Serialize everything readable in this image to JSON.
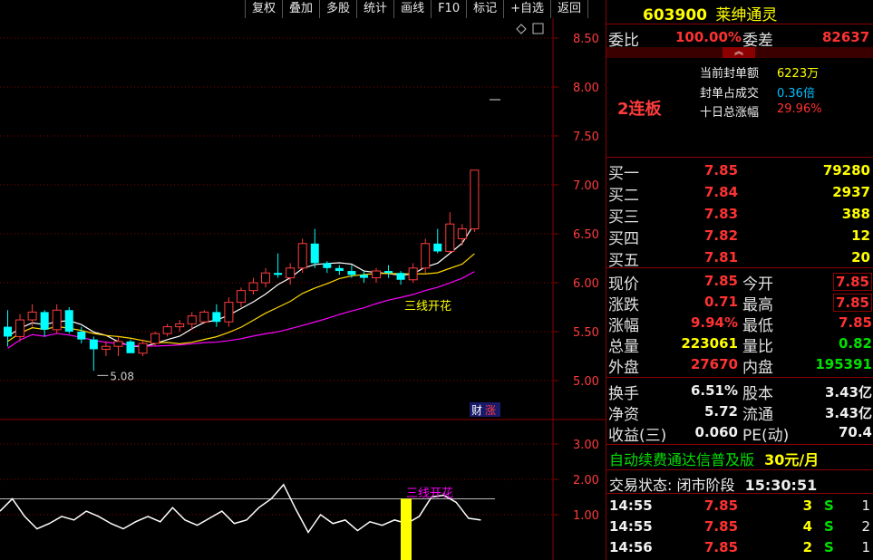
{
  "toolbar": {
    "items": [
      "复权",
      "叠加",
      "多股",
      "统计",
      "画线",
      "F10",
      "标记",
      "+自选",
      "返回"
    ]
  },
  "stock": {
    "code": "603900",
    "name": "莱绅通灵"
  },
  "weibi": {
    "label1": "委比",
    "value1": "100.00%",
    "label2": "委差",
    "value2": "82637"
  },
  "limit": {
    "streak": "2连板",
    "seal_amount_label": "当前封单额",
    "seal_amount": "6223万",
    "seal_ratio_label": "封单占成交",
    "seal_ratio": "0.36倍",
    "ten_day_label": "十日总涨幅",
    "ten_day": "29.96%"
  },
  "bids": [
    {
      "label": "买一",
      "price": "7.85",
      "vol": "79280"
    },
    {
      "label": "买二",
      "price": "7.84",
      "vol": "2937"
    },
    {
      "label": "买三",
      "price": "7.83",
      "vol": "388"
    },
    {
      "label": "买四",
      "price": "7.82",
      "vol": "12"
    },
    {
      "label": "买五",
      "price": "7.81",
      "vol": "20"
    }
  ],
  "quote": [
    {
      "l1": "现价",
      "v1": "7.85",
      "l2": "今开",
      "v2": "7.85"
    },
    {
      "l1": "涨跌",
      "v1": "0.71",
      "l2": "最高",
      "v2": "7.85"
    },
    {
      "l1": "涨幅",
      "v1": "9.94%",
      "l2": "最低",
      "v2": "7.85"
    },
    {
      "l1": "总量",
      "v1": "223061",
      "l2": "量比",
      "v2": "0.82"
    },
    {
      "l1": "外盘",
      "v1": "27670",
      "l2": "内盘",
      "v2": "195391"
    }
  ],
  "fund": [
    {
      "l1": "换手",
      "v1": "6.51%",
      "l2": "股本",
      "v2": "3.43亿"
    },
    {
      "l1": "净资",
      "v1": "5.72",
      "l2": "流通",
      "v2": "3.43亿"
    },
    {
      "l1": "收益(三)",
      "v1": "0.060",
      "l2": "PE(动)",
      "v2": "70.4"
    }
  ],
  "ad": {
    "text": "自动续费通达信普及版",
    "price": "30元/月"
  },
  "status": {
    "label": "交易状态:",
    "value": "闭市阶段",
    "time": "15:30:51"
  },
  "ticks": [
    {
      "time": "14:55",
      "price": "7.85",
      "vol": "3",
      "side": "S",
      "n": "1"
    },
    {
      "time": "14:55",
      "price": "7.85",
      "vol": "4",
      "side": "S",
      "n": "2"
    },
    {
      "time": "14:56",
      "price": "7.85",
      "vol": "2",
      "side": "S",
      "n": "1"
    }
  ],
  "chart_data": {
    "type": "candlestick",
    "price_axis_ticks": [
      "8.50",
      "8.00",
      "7.50",
      "7.00",
      "6.50",
      "6.00",
      "5.50",
      "5.00"
    ],
    "indicator_axis_ticks": [
      "3.00",
      "2.00",
      "1.00"
    ],
    "price_range": [
      4.95,
      8.6
    ],
    "low_marker": "5.08",
    "annotation": "三线开花",
    "badge": "财",
    "badge2": "涨",
    "candles": [
      [
        5.55,
        5.72,
        5.35,
        5.45
      ],
      [
        5.45,
        5.68,
        5.4,
        5.62
      ],
      [
        5.62,
        5.78,
        5.55,
        5.7
      ],
      [
        5.7,
        5.72,
        5.45,
        5.52
      ],
      [
        5.52,
        5.78,
        5.48,
        5.72
      ],
      [
        5.72,
        5.75,
        5.48,
        5.5
      ],
      [
        5.5,
        5.55,
        5.38,
        5.42
      ],
      [
        5.42,
        5.45,
        5.1,
        5.32
      ],
      [
        5.32,
        5.4,
        5.25,
        5.35
      ],
      [
        5.35,
        5.45,
        5.25,
        5.4
      ],
      [
        5.4,
        5.42,
        5.3,
        5.28
      ],
      [
        5.28,
        5.42,
        5.25,
        5.38
      ],
      [
        5.38,
        5.5,
        5.35,
        5.48
      ],
      [
        5.48,
        5.58,
        5.45,
        5.55
      ],
      [
        5.55,
        5.62,
        5.5,
        5.58
      ],
      [
        5.58,
        5.7,
        5.52,
        5.66
      ],
      [
        5.6,
        5.72,
        5.58,
        5.7
      ],
      [
        5.7,
        5.78,
        5.55,
        5.6
      ],
      [
        5.6,
        5.85,
        5.55,
        5.8
      ],
      [
        5.8,
        5.95,
        5.75,
        5.92
      ],
      [
        5.92,
        6.05,
        5.88,
        6.0
      ],
      [
        6.0,
        6.15,
        5.95,
        6.1
      ],
      [
        6.1,
        6.3,
        6.05,
        6.08
      ],
      [
        6.05,
        6.2,
        5.98,
        6.15
      ],
      [
        6.15,
        6.45,
        6.1,
        6.4
      ],
      [
        6.4,
        6.55,
        6.15,
        6.2
      ],
      [
        6.2,
        6.22,
        6.1,
        6.15
      ],
      [
        6.15,
        6.18,
        6.08,
        6.12
      ],
      [
        6.12,
        6.18,
        6.05,
        6.08
      ],
      [
        6.08,
        6.12,
        6.0,
        6.05
      ],
      [
        6.05,
        6.15,
        6.0,
        6.12
      ],
      [
        6.12,
        6.18,
        6.05,
        6.1
      ],
      [
        6.1,
        6.12,
        5.98,
        6.03
      ],
      [
        6.03,
        6.2,
        6.0,
        6.15
      ],
      [
        6.15,
        6.45,
        6.1,
        6.4
      ],
      [
        6.4,
        6.55,
        6.3,
        6.32
      ],
      [
        6.32,
        6.72,
        6.3,
        6.6
      ],
      [
        6.45,
        6.6,
        6.38,
        6.55
      ],
      [
        6.55,
        7.15,
        6.52,
        7.15
      ]
    ],
    "indicator_line": [
      1.1,
      1.45,
      0.95,
      0.6,
      0.75,
      0.95,
      0.85,
      1.1,
      0.95,
      0.75,
      0.6,
      0.8,
      0.95,
      0.8,
      1.2,
      0.85,
      0.7,
      0.9,
      1.1,
      0.75,
      0.85,
      1.2,
      1.45,
      1.85,
      1.15,
      0.5,
      1.0,
      0.75,
      0.85,
      0.55,
      0.8,
      0.7,
      0.85,
      0.75,
      0.95,
      1.5,
      1.55,
      1.35,
      0.9,
      0.85
    ],
    "indicator_ref": 1.45
  }
}
